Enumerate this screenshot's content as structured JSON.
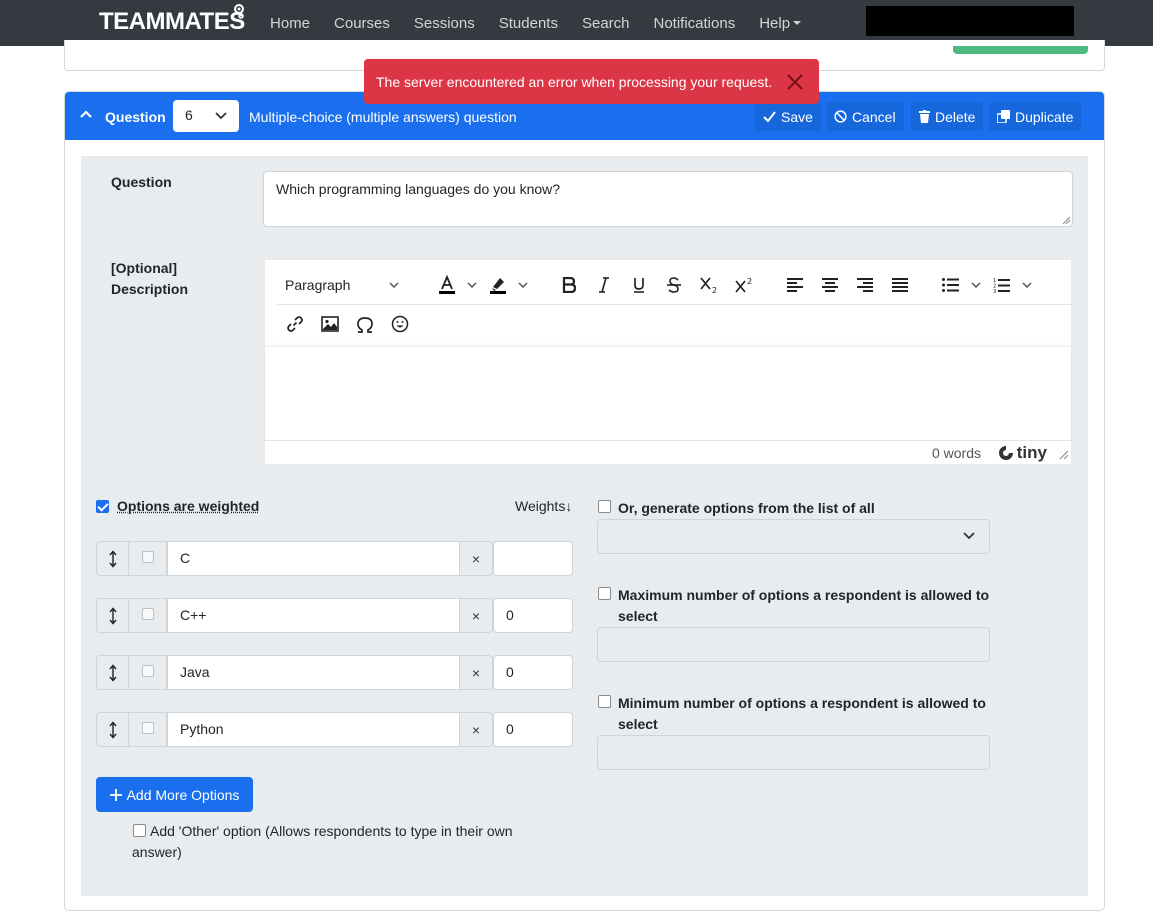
{
  "navbar": {
    "brand": "TEAMMATES",
    "links": [
      "Home",
      "Courses",
      "Sessions",
      "Students",
      "Search",
      "Notifications"
    ],
    "help": "Help"
  },
  "toast": {
    "message": "The server encountered an error when processing your request.",
    "color": "#dc3545"
  },
  "question": {
    "header_label": "Question",
    "number": "6",
    "type": "Multiple-choice (multiple answers) question",
    "buttons": {
      "save": "Save",
      "cancel": "Cancel",
      "delete": "Delete",
      "duplicate": "Duplicate"
    },
    "question_label": "Question",
    "question_text": "Which programming languages do you know?",
    "description_label_1": "[Optional]",
    "description_label_2": "Description",
    "editor": {
      "block_format": "Paragraph",
      "word_count": "0 words",
      "branding": "tiny"
    },
    "options_weighted_label": "Options are weighted",
    "weights_label": "Weights↓",
    "options": [
      {
        "text": "C",
        "weight": ""
      },
      {
        "text": "C++",
        "weight": "0"
      },
      {
        "text": "Java",
        "weight": "0"
      },
      {
        "text": "Python",
        "weight": "0"
      }
    ],
    "add_more_label": "Add More Options",
    "other_option_label": "Add 'Other' option (Allows respondents to type in their own answer)",
    "generate_label": "Or, generate options from the list of all",
    "max_label": "Maximum number of options a respondent is allowed to select",
    "min_label": "Minimum number of options a respondent is allowed to select"
  },
  "colors": {
    "header_blue": "#1a6fef",
    "navbar": "#343a40",
    "body_bg": "#e9ecef"
  }
}
